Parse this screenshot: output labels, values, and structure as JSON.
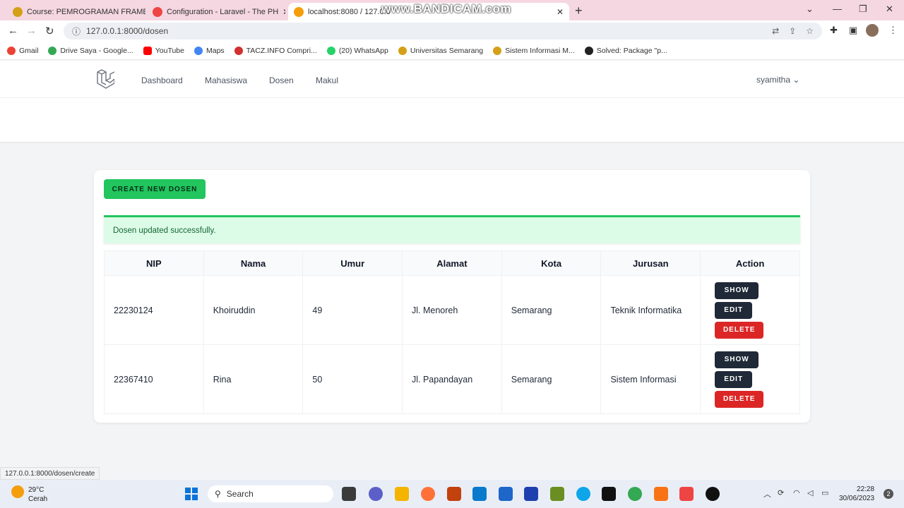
{
  "browser": {
    "tabs": [
      {
        "title": "Course: PEMROGRAMAN FRAME",
        "active": false
      },
      {
        "title": "Configuration - Laravel - The PH",
        "active": false
      },
      {
        "title": "localhost:8080 / 127.0.0",
        "active": true
      }
    ],
    "watermark": "www.BANDICAM.com",
    "url": "127.0.0.1:8000/dosen",
    "bookmarks": [
      "Gmail",
      "Drive Saya - Google...",
      "YouTube",
      "Maps",
      "TACZ.INFO Compri...",
      "(20) WhatsApp",
      "Universitas Semarang",
      "Sistem Informasi M...",
      "Solved: Package \"p..."
    ],
    "status_url": "127.0.0.1:8000/dosen/create"
  },
  "nav": {
    "links": [
      "Dashboard",
      "Mahasiswa",
      "Dosen",
      "Makul"
    ],
    "user": "syamitha"
  },
  "page": {
    "create_label": "CREATE NEW DOSEN",
    "alert": "Dosen updated successfully.",
    "table": {
      "headers": [
        "NIP",
        "Nama",
        "Umur",
        "Alamat",
        "Kota",
        "Jurusan",
        "Action"
      ],
      "rows": [
        {
          "nip": "22230124",
          "nama": "Khoiruddin",
          "umur": "49",
          "alamat": "Jl. Menoreh",
          "kota": "Semarang",
          "jurusan": "Teknik Informatika"
        },
        {
          "nip": "22367410",
          "nama": "Rina",
          "umur": "50",
          "alamat": "Jl. Papandayan",
          "kota": "Semarang",
          "jurusan": "Sistem Informasi"
        }
      ],
      "actions": {
        "show": "SHOW",
        "edit": "EDIT",
        "delete": "DELETE"
      }
    },
    "colors": {
      "success": "#22c55e",
      "danger": "#dc2626",
      "dark": "#1f2937"
    }
  },
  "taskbar": {
    "weather_temp": "29°C",
    "weather_desc": "Cerah",
    "search": "Search",
    "time": "22:28",
    "date": "30/06/2023",
    "notifications": "2"
  }
}
